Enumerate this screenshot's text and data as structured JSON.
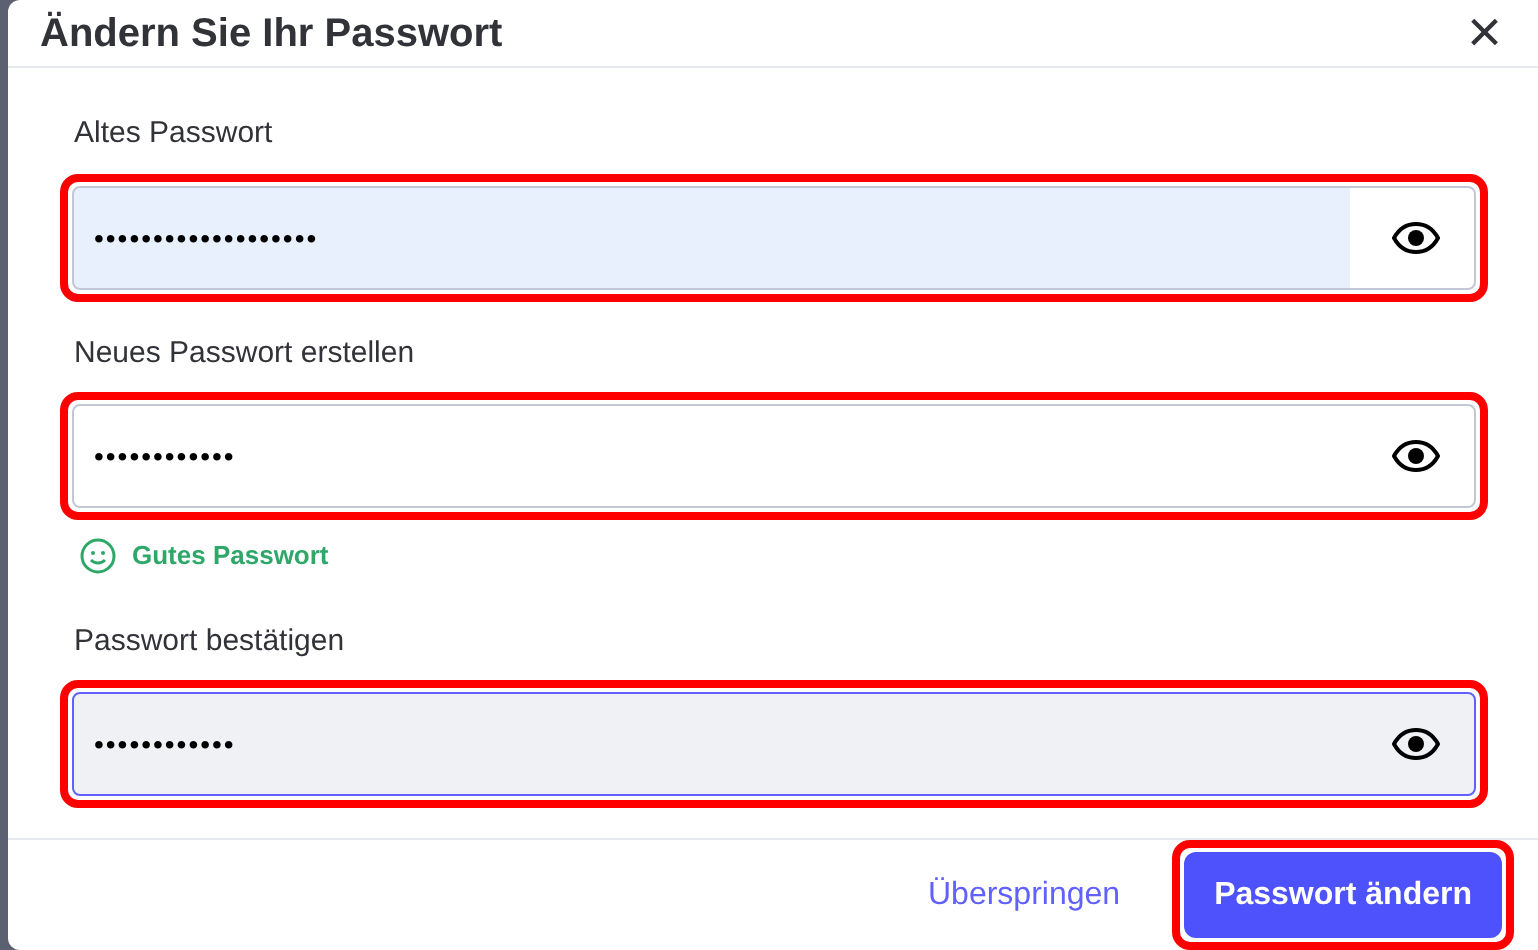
{
  "dialog": {
    "title": "Ändern Sie Ihr Passwort",
    "close": "×"
  },
  "fields": [
    {
      "label": "Altes Passwort",
      "value": "•••••••••••••••••••",
      "autofilled": true,
      "focused": false,
      "highlighted": true
    },
    {
      "label": "Neues Passwort erstellen",
      "value": "••••••••••••",
      "autofilled": false,
      "focused": false,
      "highlighted": true,
      "hint": "Gutes Passwort"
    },
    {
      "label": "Passwort bestätigen",
      "value": "••••••••••••",
      "autofilled": false,
      "focused": true,
      "highlighted": true
    }
  ],
  "buttons": [
    {
      "label": "Überspringen",
      "kind": "link",
      "highlighted": false
    },
    {
      "label": "Passwort ändern",
      "kind": "primary",
      "highlighted": true
    }
  ]
}
